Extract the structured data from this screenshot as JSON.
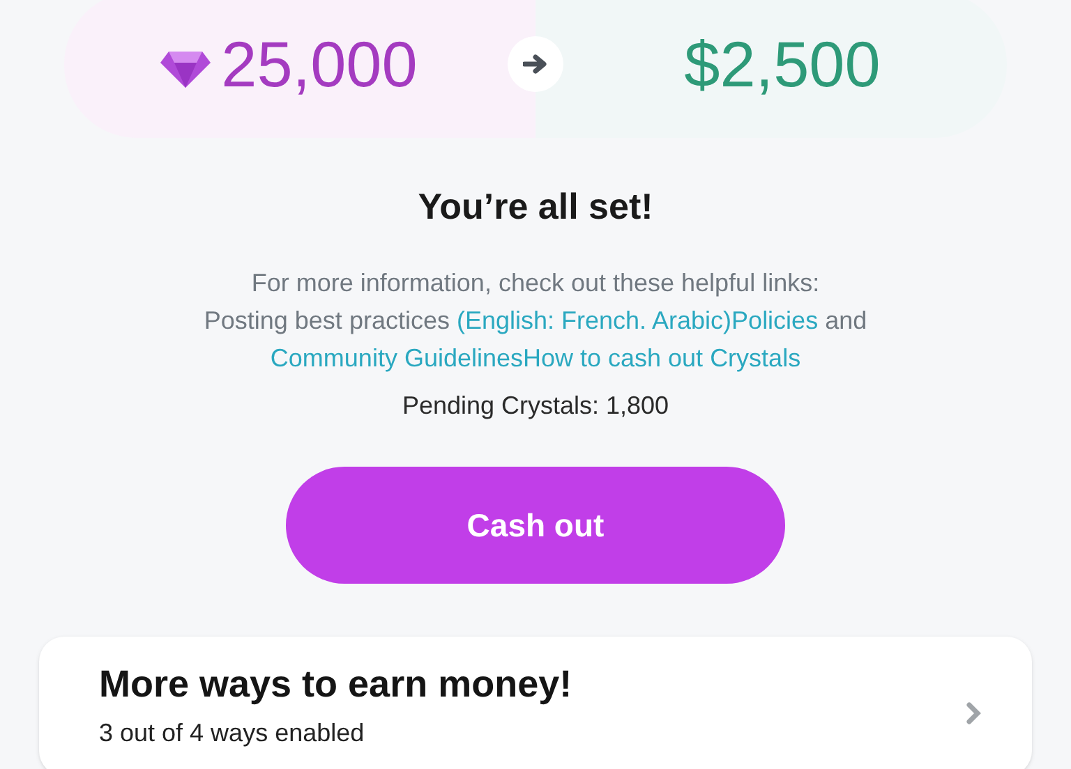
{
  "conversion": {
    "crystals": "25,000",
    "cash": "$2,500"
  },
  "title": "You’re all set!",
  "info": {
    "intro": "For more information, check out these helpful links:",
    "prefix": "Posting best practices",
    "link_1": "(English: French. Arabic)Policies",
    "joiner": "and",
    "link_2": "Community GuidelinesHow to cash out Crystals"
  },
  "pending": "Pending Crystals: 1,800",
  "cash_out_button": "Cash out",
  "earn_card": {
    "title": "More ways to earn money!",
    "subtitle": "3 out of 4 ways enabled"
  }
}
